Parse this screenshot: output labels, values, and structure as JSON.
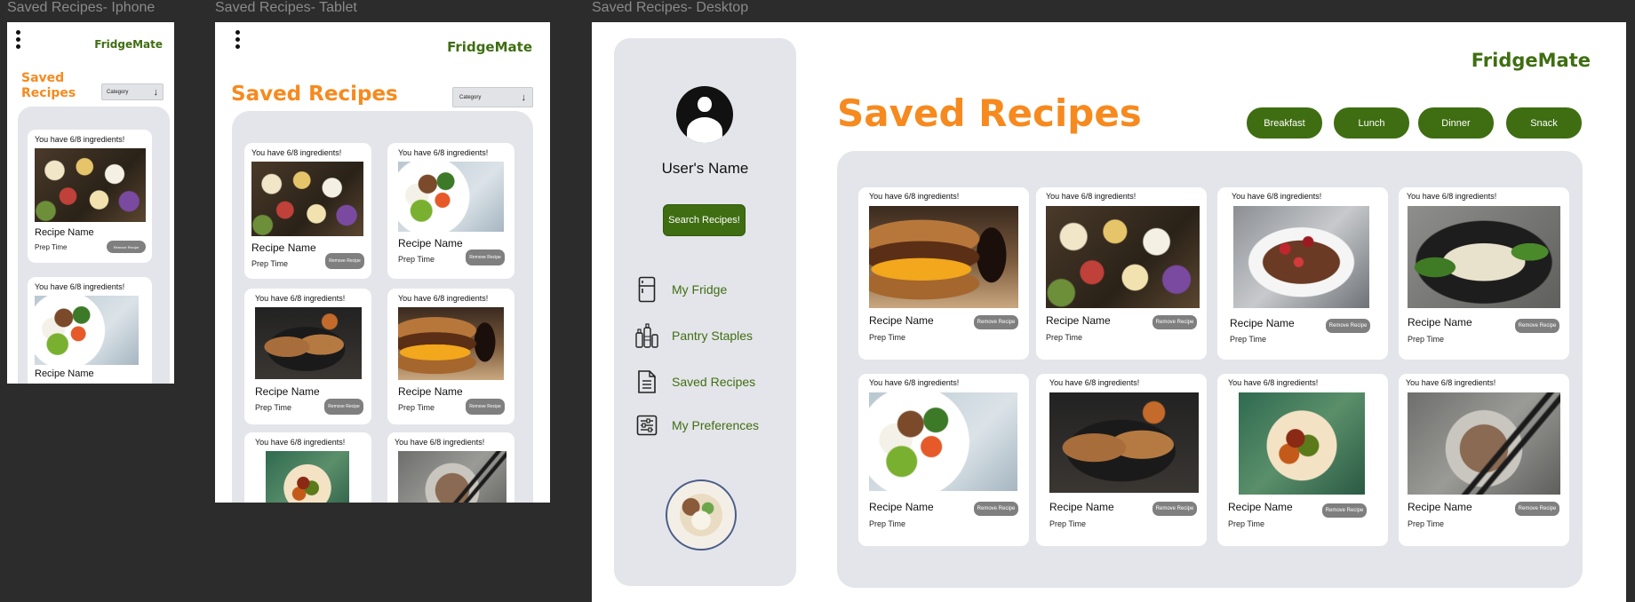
{
  "frames": {
    "iphone_label": "Saved Recipes- Iphone",
    "tablet_label": "Saved Recipes- Tablet",
    "desktop_label": "Saved Recipes- Desktop"
  },
  "brand": "FridgeMate",
  "page_title": "Saved Recipes",
  "page_title_mobile_line1": "Saved",
  "page_title_mobile_line2": "Recipes",
  "category_dropdown": {
    "selected": "Category",
    "arrow_icon": "arrow-down-icon"
  },
  "card": {
    "have_text": "You have 6/8 ingredients!",
    "recipe_name": "Recipe Name",
    "prep_time": "Prep Time",
    "remove_label": "Remove Recipe"
  },
  "sidebar": {
    "user_name": "User's Name",
    "search_button": "Search Recipes!",
    "items": [
      {
        "label": "My Fridge",
        "icon": "fridge-icon"
      },
      {
        "label": "Pantry Staples",
        "icon": "pantry-icon"
      },
      {
        "label": "Saved Recipes",
        "icon": "document-icon"
      },
      {
        "label": "My Preferences",
        "icon": "sliders-icon"
      }
    ]
  },
  "filters": [
    "Breakfast",
    "Lunch",
    "Dinner",
    "Snack"
  ],
  "colors": {
    "brand_green": "#3f6e12",
    "title_orange": "#f68a1f",
    "panel_gray": "#e4e5ea",
    "remove_gray": "#7f7f7f"
  }
}
